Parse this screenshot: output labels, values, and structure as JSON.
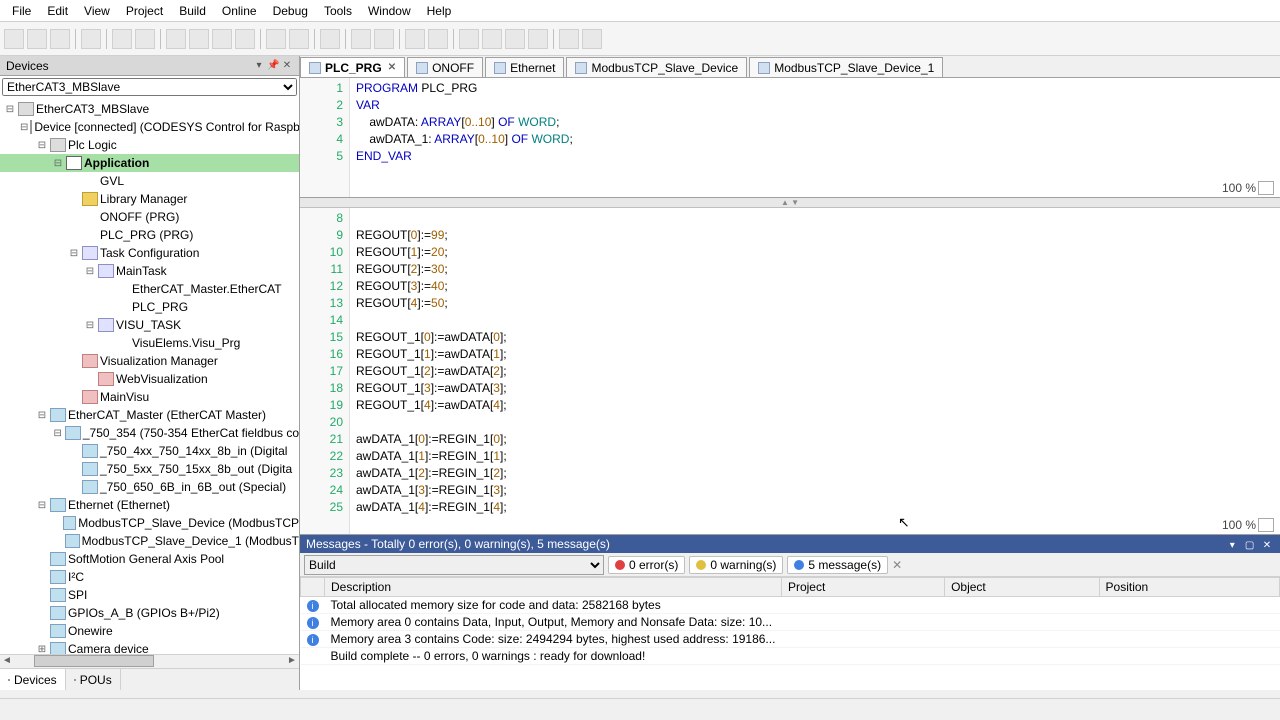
{
  "menu": [
    "File",
    "Edit",
    "View",
    "Project",
    "Build",
    "Online",
    "Debug",
    "Tools",
    "Window",
    "Help"
  ],
  "devices": {
    "title": "Devices",
    "root": "EtherCAT3_MBSlave",
    "tree": [
      {
        "ind": 0,
        "exp": "-",
        "ic": "ic-dev",
        "lbl": "EtherCAT3_MBSlave",
        "name": "project-root"
      },
      {
        "ind": 1,
        "exp": "-",
        "ic": "ic-dev",
        "lbl": "Device [connected] (CODESYS Control for Raspb",
        "name": "device"
      },
      {
        "ind": 2,
        "exp": "-",
        "ic": "ic-dev",
        "lbl": "Plc Logic",
        "name": "plc-logic"
      },
      {
        "ind": 3,
        "exp": "-",
        "ic": "ic-app",
        "lbl": "Application",
        "bold": true,
        "sel": true,
        "name": "application"
      },
      {
        "ind": 4,
        "exp": "",
        "ic": "ic-pou",
        "lbl": "GVL",
        "name": "gvl"
      },
      {
        "ind": 4,
        "exp": "",
        "ic": "ic-lib",
        "lbl": "Library Manager",
        "name": "library-manager"
      },
      {
        "ind": 4,
        "exp": "",
        "ic": "ic-pou",
        "lbl": "ONOFF (PRG)",
        "name": "onoff-prg"
      },
      {
        "ind": 4,
        "exp": "",
        "ic": "ic-pou",
        "lbl": "PLC_PRG (PRG)",
        "name": "plc-prg"
      },
      {
        "ind": 4,
        "exp": "-",
        "ic": "ic-task",
        "lbl": "Task Configuration",
        "name": "task-config"
      },
      {
        "ind": 5,
        "exp": "-",
        "ic": "ic-task",
        "lbl": "MainTask",
        "name": "maintask"
      },
      {
        "ind": 6,
        "exp": "",
        "ic": "ic-pou",
        "lbl": "EtherCAT_Master.EtherCAT",
        "name": "ethercat-task"
      },
      {
        "ind": 6,
        "exp": "",
        "ic": "ic-pou",
        "lbl": "PLC_PRG",
        "name": "plcprg-task"
      },
      {
        "ind": 5,
        "exp": "-",
        "ic": "ic-task",
        "lbl": "VISU_TASK",
        "name": "visu-task"
      },
      {
        "ind": 6,
        "exp": "",
        "ic": "ic-pou",
        "lbl": "VisuElems.Visu_Prg",
        "name": "visuelems"
      },
      {
        "ind": 4,
        "exp": "",
        "ic": "ic-vis",
        "lbl": "Visualization Manager",
        "name": "vis-manager"
      },
      {
        "ind": 5,
        "exp": "",
        "ic": "ic-vis",
        "lbl": "WebVisualization",
        "name": "webvis"
      },
      {
        "ind": 4,
        "exp": "",
        "ic": "ic-vis",
        "lbl": "MainVisu",
        "name": "mainvisu"
      },
      {
        "ind": 2,
        "exp": "-",
        "ic": "ic-eth",
        "lbl": "EtherCAT_Master (EtherCAT Master)",
        "name": "ethercat-master"
      },
      {
        "ind": 3,
        "exp": "-",
        "ic": "ic-eth",
        "lbl": "_750_354 (750-354 EtherCat fieldbus co",
        "name": "750-354"
      },
      {
        "ind": 4,
        "exp": "",
        "ic": "ic-eth",
        "lbl": "_750_4xx_750_14xx_8b_in (Digital",
        "name": "750-4xx"
      },
      {
        "ind": 4,
        "exp": "",
        "ic": "ic-eth",
        "lbl": "_750_5xx_750_15xx_8b_out (Digita",
        "name": "750-5xx"
      },
      {
        "ind": 4,
        "exp": "",
        "ic": "ic-eth",
        "lbl": "_750_650_6B_in_6B_out (Special)",
        "name": "750-650"
      },
      {
        "ind": 2,
        "exp": "-",
        "ic": "ic-eth",
        "lbl": "Ethernet (Ethernet)",
        "name": "ethernet"
      },
      {
        "ind": 3,
        "exp": "",
        "ic": "ic-eth",
        "lbl": "ModbusTCP_Slave_Device (ModbusTCP",
        "name": "modbus1"
      },
      {
        "ind": 3,
        "exp": "",
        "ic": "ic-eth",
        "lbl": "ModbusTCP_Slave_Device_1 (ModbusT",
        "name": "modbus2"
      },
      {
        "ind": 2,
        "exp": "",
        "ic": "ic-eth",
        "lbl": "SoftMotion General Axis Pool",
        "name": "softmotion"
      },
      {
        "ind": 2,
        "exp": "",
        "ic": "ic-eth",
        "lbl": "I²C",
        "name": "i2c"
      },
      {
        "ind": 2,
        "exp": "",
        "ic": "ic-eth",
        "lbl": "SPI",
        "name": "spi"
      },
      {
        "ind": 2,
        "exp": "",
        "ic": "ic-eth",
        "lbl": "GPIOs_A_B (GPIOs B+/Pi2)",
        "name": "gpios"
      },
      {
        "ind": 2,
        "exp": "",
        "ic": "ic-eth",
        "lbl": "Onewire",
        "name": "onewire"
      },
      {
        "ind": 2,
        "exp": "+",
        "ic": "ic-eth",
        "lbl": "Camera device",
        "name": "camera"
      }
    ],
    "tabs": [
      {
        "lbl": "Devices",
        "act": true
      },
      {
        "lbl": "POUs",
        "act": false
      }
    ]
  },
  "editor_tabs": [
    {
      "lbl": "PLC_PRG",
      "act": true,
      "close": true
    },
    {
      "lbl": "ONOFF",
      "act": false
    },
    {
      "lbl": "Ethernet",
      "act": false
    },
    {
      "lbl": "ModbusTCP_Slave_Device",
      "act": false
    },
    {
      "lbl": "ModbusTCP_Slave_Device_1",
      "act": false
    }
  ],
  "decl": {
    "lines": [
      {
        "n": 1,
        "raw": "PROGRAM PLC_PRG",
        "tok": [
          [
            "kw",
            "PROGRAM"
          ],
          [
            "",
            " PLC_PRG"
          ]
        ]
      },
      {
        "n": 2,
        "raw": "VAR",
        "tok": [
          [
            "kw",
            "VAR"
          ]
        ]
      },
      {
        "n": 3,
        "raw": "    awDATA: ARRAY[0..10] OF WORD;",
        "tok": [
          [
            "",
            "    awDATA: "
          ],
          [
            "kw",
            "ARRAY"
          ],
          [
            "",
            "["
          ],
          [
            "num",
            "0..10"
          ],
          [
            "",
            "] "
          ],
          [
            "kw",
            "OF"
          ],
          [
            "",
            " "
          ],
          [
            "typ",
            "WORD"
          ],
          [
            "",
            ";"
          ]
        ]
      },
      {
        "n": 4,
        "raw": "    awDATA_1: ARRAY[0..10] OF WORD;",
        "tok": [
          [
            "",
            "    awDATA_1: "
          ],
          [
            "kw",
            "ARRAY"
          ],
          [
            "",
            "["
          ],
          [
            "num",
            "0..10"
          ],
          [
            "",
            "] "
          ],
          [
            "kw",
            "OF"
          ],
          [
            "",
            " "
          ],
          [
            "typ",
            "WORD"
          ],
          [
            "",
            ";"
          ]
        ]
      },
      {
        "n": 5,
        "raw": "END_VAR",
        "tok": [
          [
            "kw",
            "END_VAR"
          ]
        ]
      }
    ],
    "zoom": "100 %"
  },
  "impl": {
    "lines": [
      {
        "n": 8,
        "raw": ""
      },
      {
        "n": 9,
        "raw": "REGOUT[0]:=99;",
        "tok": [
          [
            "",
            "REGOUT["
          ],
          [
            "num",
            "0"
          ],
          [
            "",
            "]:="
          ],
          [
            "num",
            "99"
          ],
          [
            "",
            ";"
          ]
        ]
      },
      {
        "n": 10,
        "raw": "REGOUT[1]:=20;",
        "tok": [
          [
            "",
            "REGOUT["
          ],
          [
            "num",
            "1"
          ],
          [
            "",
            "]:="
          ],
          [
            "num",
            "20"
          ],
          [
            "",
            ";"
          ]
        ]
      },
      {
        "n": 11,
        "raw": "REGOUT[2]:=30;",
        "tok": [
          [
            "",
            "REGOUT["
          ],
          [
            "num",
            "2"
          ],
          [
            "",
            "]:="
          ],
          [
            "num",
            "30"
          ],
          [
            "",
            ";"
          ]
        ]
      },
      {
        "n": 12,
        "raw": "REGOUT[3]:=40;",
        "tok": [
          [
            "",
            "REGOUT["
          ],
          [
            "num",
            "3"
          ],
          [
            "",
            "]:="
          ],
          [
            "num",
            "40"
          ],
          [
            "",
            ";"
          ]
        ]
      },
      {
        "n": 13,
        "raw": "REGOUT[4]:=50;",
        "tok": [
          [
            "",
            "REGOUT["
          ],
          [
            "num",
            "4"
          ],
          [
            "",
            "]:="
          ],
          [
            "num",
            "50"
          ],
          [
            "",
            ";"
          ]
        ]
      },
      {
        "n": 14,
        "raw": ""
      },
      {
        "n": 15,
        "raw": "REGOUT_1[0]:=awDATA[0];",
        "tok": [
          [
            "",
            "REGOUT_1["
          ],
          [
            "num",
            "0"
          ],
          [
            "",
            "]:=awDATA["
          ],
          [
            "num",
            "0"
          ],
          [
            "",
            "];"
          ]
        ]
      },
      {
        "n": 16,
        "raw": "REGOUT_1[1]:=awDATA[1];",
        "tok": [
          [
            "",
            "REGOUT_1["
          ],
          [
            "num",
            "1"
          ],
          [
            "",
            "]:=awDATA["
          ],
          [
            "num",
            "1"
          ],
          [
            "",
            "];"
          ]
        ]
      },
      {
        "n": 17,
        "raw": "REGOUT_1[2]:=awDATA[2];",
        "tok": [
          [
            "",
            "REGOUT_1["
          ],
          [
            "num",
            "2"
          ],
          [
            "",
            "]:=awDATA["
          ],
          [
            "num",
            "2"
          ],
          [
            "",
            "];"
          ]
        ]
      },
      {
        "n": 18,
        "raw": "REGOUT_1[3]:=awDATA[3];",
        "tok": [
          [
            "",
            "REGOUT_1["
          ],
          [
            "num",
            "3"
          ],
          [
            "",
            "]:=awDATA["
          ],
          [
            "num",
            "3"
          ],
          [
            "",
            "];"
          ]
        ]
      },
      {
        "n": 19,
        "raw": "REGOUT_1[4]:=awDATA[4];",
        "tok": [
          [
            "",
            "REGOUT_1["
          ],
          [
            "num",
            "4"
          ],
          [
            "",
            "]:=awDATA["
          ],
          [
            "num",
            "4"
          ],
          [
            "",
            "];"
          ]
        ]
      },
      {
        "n": 20,
        "raw": ""
      },
      {
        "n": 21,
        "raw": "awDATA_1[0]:=REGIN_1[0];",
        "tok": [
          [
            "",
            "awDATA_1["
          ],
          [
            "num",
            "0"
          ],
          [
            "",
            "]:=REGIN_1["
          ],
          [
            "num",
            "0"
          ],
          [
            "",
            "];"
          ]
        ]
      },
      {
        "n": 22,
        "raw": "awDATA_1[1]:=REGIN_1[1];",
        "tok": [
          [
            "",
            "awDATA_1["
          ],
          [
            "num",
            "1"
          ],
          [
            "",
            "]:=REGIN_1["
          ],
          [
            "num",
            "1"
          ],
          [
            "",
            "];"
          ]
        ]
      },
      {
        "n": 23,
        "raw": "awDATA_1[2]:=REGIN_1[2];",
        "tok": [
          [
            "",
            "awDATA_1["
          ],
          [
            "num",
            "2"
          ],
          [
            "",
            "]:=REGIN_1["
          ],
          [
            "num",
            "2"
          ],
          [
            "",
            "];"
          ]
        ]
      },
      {
        "n": 24,
        "raw": "awDATA_1[3]:=REGIN_1[3];",
        "tok": [
          [
            "",
            "awDATA_1["
          ],
          [
            "num",
            "3"
          ],
          [
            "",
            "]:=REGIN_1["
          ],
          [
            "num",
            "3"
          ],
          [
            "",
            "];"
          ]
        ]
      },
      {
        "n": 25,
        "raw": "awDATA_1[4]:=REGIN_1[4];",
        "tok": [
          [
            "",
            "awDATA_1["
          ],
          [
            "num",
            "4"
          ],
          [
            "",
            "]:=REGIN_1["
          ],
          [
            "num",
            "4"
          ],
          [
            "",
            "];"
          ]
        ]
      }
    ],
    "zoom": "100 %"
  },
  "messages": {
    "title": "Messages - Totally 0 error(s), 0 warning(s), 5 message(s)",
    "filter": "Build",
    "pills": {
      "err": "0 error(s)",
      "warn": "0 warning(s)",
      "msg": "5 message(s)"
    },
    "cols": [
      "Description",
      "Project",
      "Object",
      "Position"
    ],
    "rows": [
      {
        "ic": "i",
        "desc": "Total allocated memory size for code and data: 2582168 bytes",
        "proj": "",
        "obj": "",
        "pos": ""
      },
      {
        "ic": "i",
        "desc": "Memory area 0 contains  Data, Input, Output, Memory and Nonsafe Data: size: 10...",
        "proj": "",
        "obj": "",
        "pos": ""
      },
      {
        "ic": "i",
        "desc": "Memory area 3 contains  Code: size: 2494294 bytes, highest used address: 19186...",
        "proj": "",
        "obj": "",
        "pos": ""
      },
      {
        "ic": "",
        "desc": "Build complete -- 0 errors, 0 warnings : ready for download!",
        "proj": "",
        "obj": "",
        "pos": ""
      }
    ]
  }
}
